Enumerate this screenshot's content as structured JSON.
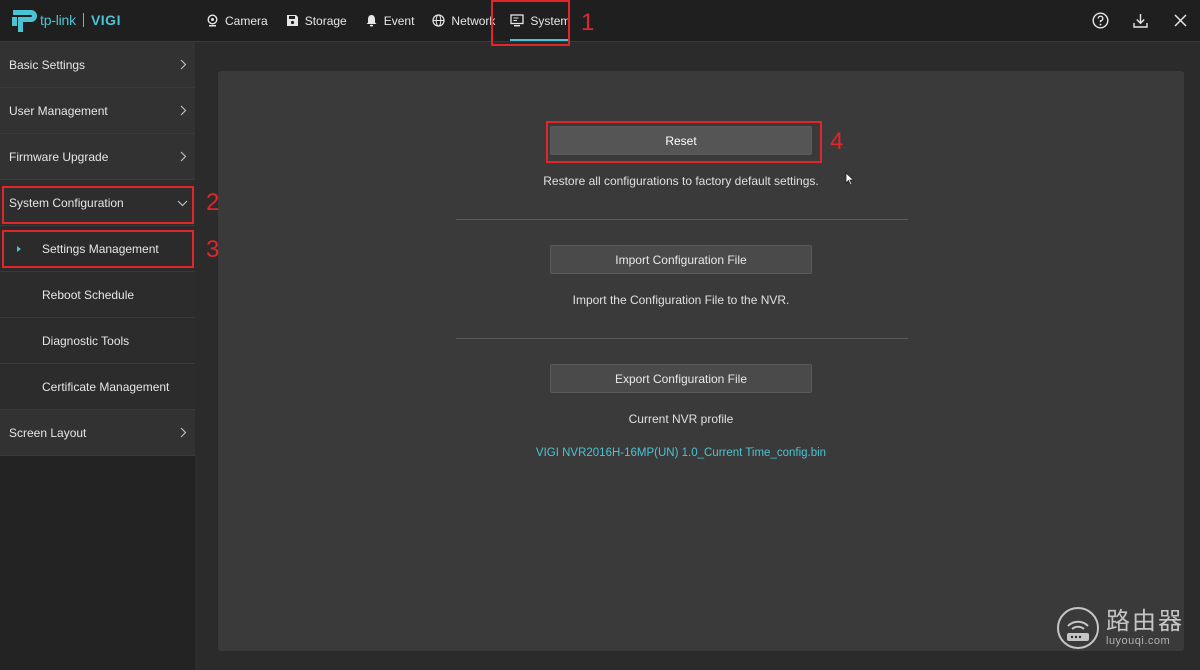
{
  "brand": {
    "name": "tp-link",
    "product": "VIGI",
    "accent": "#4cc3d3"
  },
  "nav": [
    {
      "label": "Camera",
      "icon": "camera-icon"
    },
    {
      "label": "Storage",
      "icon": "storage-icon"
    },
    {
      "label": "Event",
      "icon": "bell-icon"
    },
    {
      "label": "Network",
      "icon": "globe-icon"
    },
    {
      "label": "System",
      "icon": "monitor-icon",
      "active": true
    }
  ],
  "top_icons": [
    "help-icon",
    "download-icon",
    "close-icon"
  ],
  "sidebar": {
    "items": [
      {
        "label": "Basic Settings"
      },
      {
        "label": "User Management"
      },
      {
        "label": "Firmware Upgrade"
      },
      {
        "label": "System Configuration",
        "expanded": true
      },
      {
        "label": "Settings Management",
        "selected": true
      },
      {
        "label": "Reboot Schedule"
      },
      {
        "label": "Diagnostic Tools"
      },
      {
        "label": "Certificate Management"
      },
      {
        "label": "Screen Layout"
      }
    ]
  },
  "main": {
    "reset": {
      "label": "Reset",
      "description": "Restore all configurations to factory default settings."
    },
    "import": {
      "label": "Import Configuration File",
      "description": "Import the Configuration File to the NVR."
    },
    "export": {
      "label": "Export Configuration File",
      "description": "Current NVR profile",
      "file": "VIGI NVR2016H-16MP(UN) 1.0_Current Time_config.bin"
    }
  },
  "annotations": {
    "m1": "1",
    "m2": "2",
    "m3": "3",
    "m4": "4",
    "color": "#e0262a"
  },
  "watermark": {
    "title": "路由器",
    "url": "luyouqi.com"
  }
}
